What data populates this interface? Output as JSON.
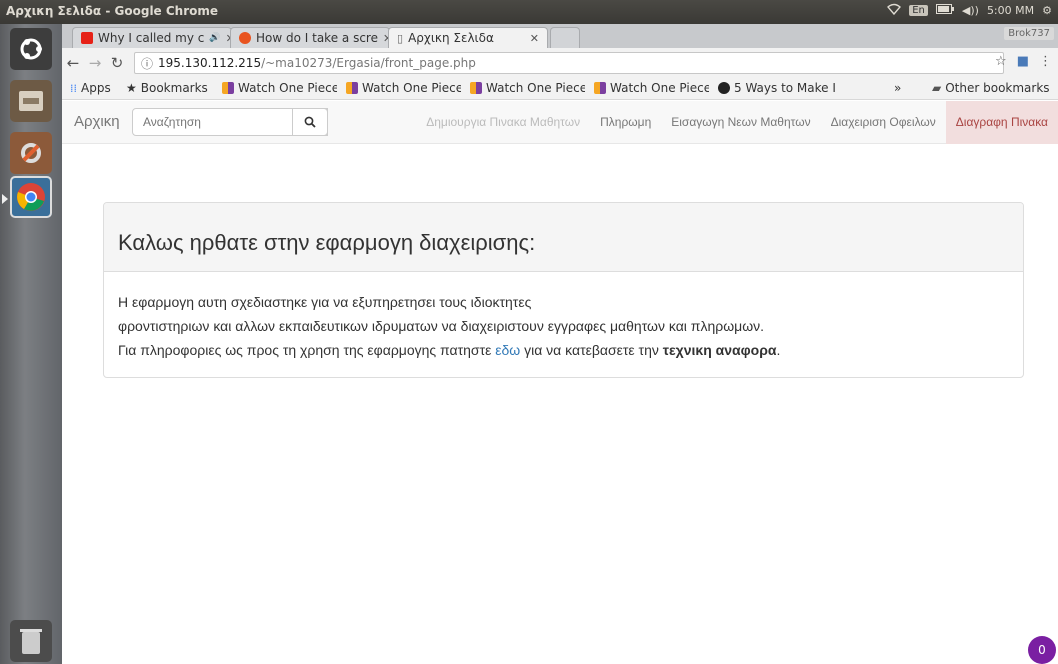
{
  "top_panel": {
    "window_title": "Αρχικη Σελιδα - Google Chrome",
    "keyboard_layout": "En",
    "time": "5:00 ΜΜ"
  },
  "launcher": {
    "items": [
      "ubuntu-dash",
      "files",
      "system-settings",
      "chrome",
      "trash"
    ]
  },
  "browser": {
    "tabs": [
      {
        "title": "Why I called my c",
        "icon": "youtube-icon",
        "audio": "🔊"
      },
      {
        "title": "How do I take a scre",
        "icon": "askubuntu-icon"
      },
      {
        "title": "Αρχικη Σελιδα",
        "icon": "page-icon",
        "active": true
      }
    ],
    "profile_name": "Brok737",
    "address": {
      "host": "195.130.112.215",
      "path": "/~ma10273/Ergasia/front_page.php"
    },
    "bookmarks": [
      {
        "label": "Apps",
        "icon": "apps-icon"
      },
      {
        "label": "Bookmarks",
        "icon": "star-icon"
      },
      {
        "label": "Watch One Piece",
        "icon": "bookmark-favicon"
      },
      {
        "label": "Watch One Piece",
        "icon": "bookmark-favicon"
      },
      {
        "label": "Watch One Piece",
        "icon": "bookmark-favicon"
      },
      {
        "label": "Watch One Piece",
        "icon": "bookmark-favicon"
      },
      {
        "label": "5 Ways to Make I",
        "icon": "wikihow-icon"
      }
    ],
    "overflow_label": "»",
    "other_bookmarks": "Other bookmarks"
  },
  "page": {
    "brand": "Αρχικη",
    "search_placeholder": "Αναζητηση",
    "nav": [
      {
        "label": "Δημιουργια Πινακα Μαθητων",
        "state": "disabled"
      },
      {
        "label": "Πληρωμη",
        "state": "normal"
      },
      {
        "label": "Εισαγωγη Νεων Μαθητων",
        "state": "normal"
      },
      {
        "label": "Διαχειριση Οφειλων",
        "state": "normal"
      },
      {
        "label": "Διαγραφη Πινακα",
        "state": "danger"
      }
    ],
    "panel": {
      "heading": "Καλως ηρθατε στην εφαρμογη διαχειρισης:",
      "line1": "Η εφαρμογη αυτη σχεδιαστηκε για να εξυπηρετησει τους ιδιοκτητες",
      "line2": "φροντιστηριων και αλλων εκπαιδευτικων ιδρυματων να διαχειριστουν εγγραφες μαθητων και πληρωμων.",
      "line3_before": "Για πληροφοριες ως προς τη χρηση της εφαρμογης πατηστε ",
      "line3_link": "εδω",
      "line3_middle": " για να κατεβασετε την ",
      "line3_bold": "τεχνικη αναφορα",
      "line3_end": "."
    },
    "badge_count": "0"
  },
  "colors": {
    "navbar_bg": "#f8f8f8",
    "danger_bg": "#f2dede",
    "link": "#337ab7",
    "badge": "#7a1fa2"
  }
}
